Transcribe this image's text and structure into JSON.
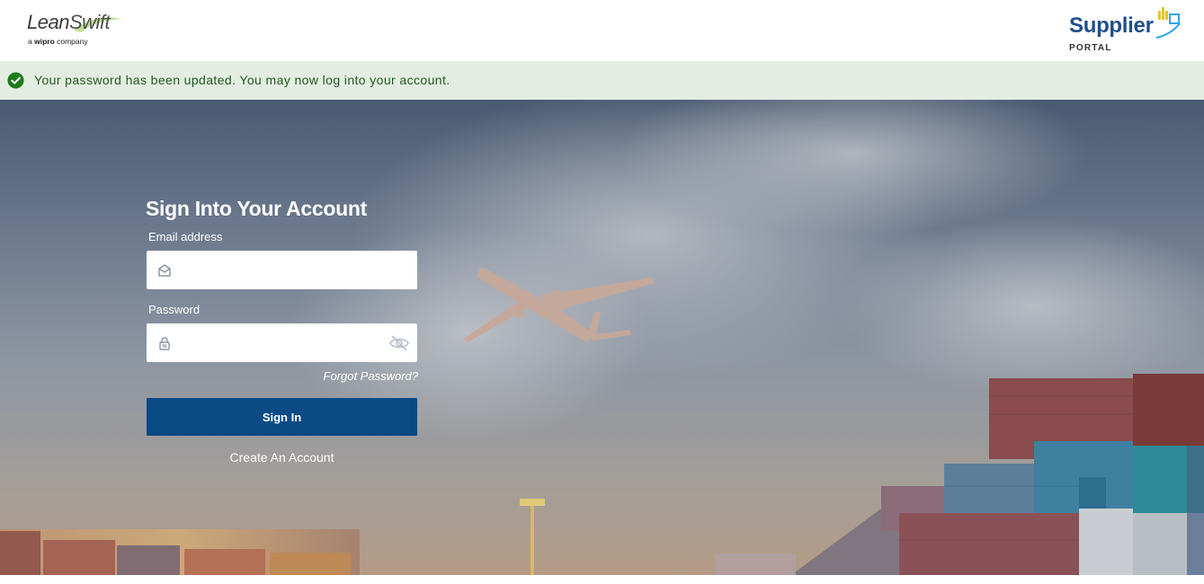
{
  "header": {
    "brand_left": {
      "name_part1": "Lean",
      "name_part2": "Swift",
      "tagline_prefix": "a ",
      "tagline_bold": "wipro",
      "tagline_suffix": " company"
    },
    "brand_right": {
      "name": "Supplier",
      "subtitle": "PORTAL"
    }
  },
  "alert": {
    "message": "Your password has been updated. You may now log into your account.",
    "icon": "check-circle-icon",
    "color": "#1f5b1f",
    "background": "#e4ede2"
  },
  "signin_form": {
    "title": "Sign Into Your Account",
    "email_label": "Email address",
    "email_value": "",
    "password_label": "Password",
    "password_value": "",
    "forgot_link": "Forgot Password?",
    "submit_label": "Sign In",
    "create_account_link": "Create An Account"
  },
  "colors": {
    "primary_button": "#0a4a85",
    "supplier_brand": "#1f4f8a"
  }
}
